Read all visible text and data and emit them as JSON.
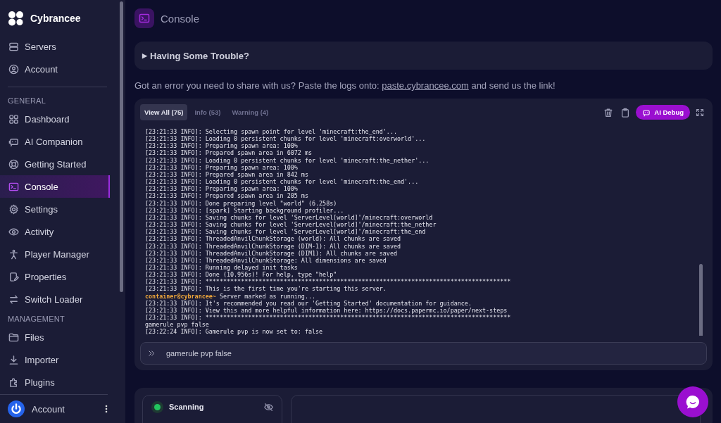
{
  "brand": {
    "name": "Cybrancee"
  },
  "sidebar": {
    "top_items": [
      {
        "label": "Servers",
        "selected": false
      },
      {
        "label": "Account",
        "selected": false
      }
    ],
    "sections": [
      {
        "heading": "GENERAL",
        "items": [
          {
            "label": "Dashboard",
            "selected": false
          },
          {
            "label": "AI Companion",
            "selected": false
          },
          {
            "label": "Getting Started",
            "selected": false
          },
          {
            "label": "Console",
            "selected": true
          },
          {
            "label": "Settings",
            "selected": false
          },
          {
            "label": "Activity",
            "selected": false
          },
          {
            "label": "Player Manager",
            "selected": false
          },
          {
            "label": "Properties",
            "selected": false
          },
          {
            "label": "Switch Loader",
            "selected": false
          }
        ]
      },
      {
        "heading": "MANAGEMENT",
        "items": [
          {
            "label": "Files",
            "selected": false
          },
          {
            "label": "Importer",
            "selected": false
          },
          {
            "label": "Plugins",
            "selected": false
          }
        ]
      }
    ],
    "footer": {
      "label": "Account"
    }
  },
  "page": {
    "title": "Console"
  },
  "trouble": {
    "marker": "▶",
    "label": "Having Some Trouble?"
  },
  "notice": {
    "before": "Got an error you need to share with us? Paste the logs onto: ",
    "link": "paste.cybrancee.com",
    "after": " and send us the link!"
  },
  "console": {
    "tabs": [
      {
        "label": "View All (75)",
        "selected": true
      },
      {
        "label": "Info (53)",
        "selected": false
      },
      {
        "label": "Warning (4)",
        "selected": false
      }
    ],
    "debug_button": "AI Debug",
    "lines": [
      {
        "kind": "log",
        "text": "[23:21:33 INFO]: Selecting spawn point for level 'minecraft:the_end'..."
      },
      {
        "kind": "log",
        "text": "[23:21:33 INFO]: Loading 0 persistent chunks for level 'minecraft:overworld'..."
      },
      {
        "kind": "log",
        "text": "[23:21:33 INFO]: Preparing spawn area: 100%"
      },
      {
        "kind": "log",
        "text": "[23:21:33 INFO]: Prepared spawn area in 6072 ms"
      },
      {
        "kind": "log",
        "text": "[23:21:33 INFO]: Loading 0 persistent chunks for level 'minecraft:the_nether'..."
      },
      {
        "kind": "log",
        "text": "[23:21:33 INFO]: Preparing spawn area: 100%"
      },
      {
        "kind": "log",
        "text": "[23:21:33 INFO]: Prepared spawn area in 842 ms"
      },
      {
        "kind": "log",
        "text": "[23:21:33 INFO]: Loading 0 persistent chunks for level 'minecraft:the_end'..."
      },
      {
        "kind": "log",
        "text": "[23:21:33 INFO]: Preparing spawn area: 100%"
      },
      {
        "kind": "log",
        "text": "[23:21:33 INFO]: Prepared spawn area in 205 ms"
      },
      {
        "kind": "log",
        "text": "[23:21:33 INFO]: Done preparing level \"world\" (6.258s)"
      },
      {
        "kind": "log",
        "text": "[23:21:33 INFO]: [spark] Starting background profiler..."
      },
      {
        "kind": "log",
        "text": "[23:21:33 INFO]: Saving chunks for level 'ServerLevel[world]'/minecraft:overworld"
      },
      {
        "kind": "log",
        "text": "[23:21:33 INFO]: Saving chunks for level 'ServerLevel[world]'/minecraft:the_nether"
      },
      {
        "kind": "log",
        "text": "[23:21:33 INFO]: Saving chunks for level 'ServerLevel[world]'/minecraft:the_end"
      },
      {
        "kind": "log",
        "text": "[23:21:33 INFO]: ThreadedAnvilChunkStorage (world): All chunks are saved"
      },
      {
        "kind": "log",
        "text": "[23:21:33 INFO]: ThreadedAnvilChunkStorage (DIM-1): All chunks are saved"
      },
      {
        "kind": "log",
        "text": "[23:21:33 INFO]: ThreadedAnvilChunkStorage (DIM1): All chunks are saved"
      },
      {
        "kind": "log",
        "text": "[23:21:33 INFO]: ThreadedAnvilChunkStorage: All dimensions are saved"
      },
      {
        "kind": "log",
        "text": "[23:21:33 INFO]: Running delayed init tasks"
      },
      {
        "kind": "log",
        "text": "[23:21:33 INFO]: Done (10.956s)! For help, type \"help\""
      },
      {
        "kind": "log",
        "text": "[23:21:33 INFO]: **************************************************************************************"
      },
      {
        "kind": "log",
        "text": "[23:21:33 INFO]: This is the first time you're starting this server."
      },
      {
        "kind": "prompt",
        "prefix": "container@cybrancee~",
        "text": "Server marked as running..."
      },
      {
        "kind": "log",
        "text": "[23:21:33 INFO]: It's recommended you read our 'Getting Started' documentation for guidance."
      },
      {
        "kind": "log",
        "text": "[23:21:33 INFO]: View this and more helpful information here: https://docs.papermc.io/paper/next-steps"
      },
      {
        "kind": "log",
        "text": "[23:21:33 INFO]: **************************************************************************************"
      },
      {
        "kind": "log",
        "text": "gamerule pvp false"
      },
      {
        "kind": "log",
        "text": "[23:22:24 INFO]: Gamerule pvp is now set to: false"
      }
    ],
    "command": {
      "value": "gamerule pvp false"
    }
  },
  "status": {
    "label": "Scanning",
    "color": "#22c55e"
  }
}
